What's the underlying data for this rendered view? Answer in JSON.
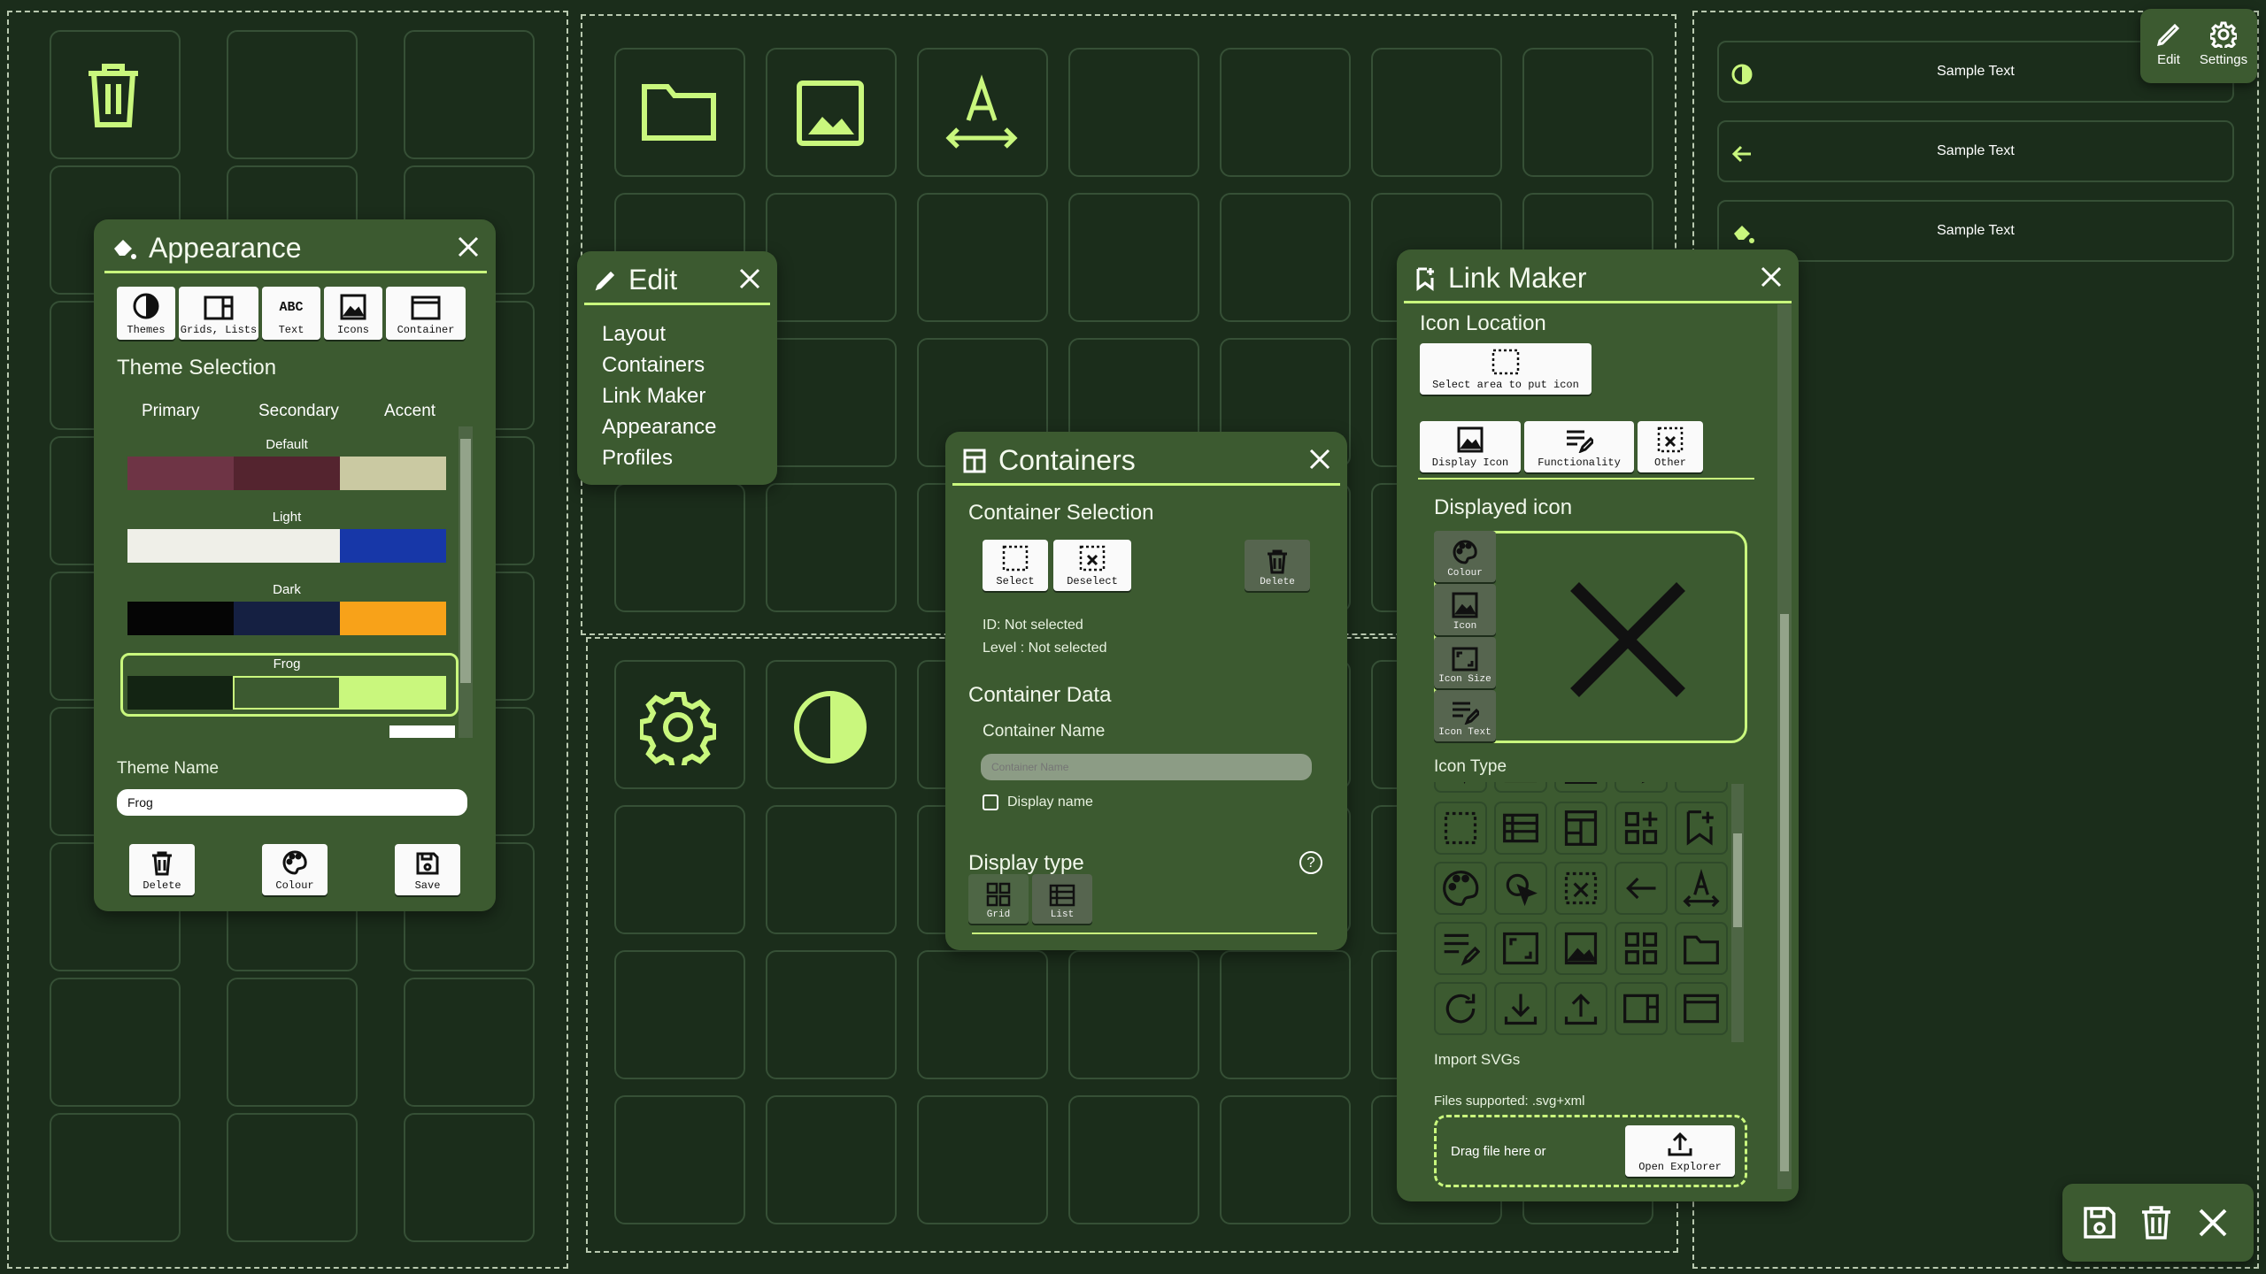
{
  "toolbar": {
    "edit_label": "Edit",
    "settings_label": "Settings"
  },
  "samples": [
    {
      "text": "Sample Text",
      "icon": "half-circle-icon"
    },
    {
      "text": "Sample Text",
      "icon": "arrow-left-icon"
    },
    {
      "text": "Sample Text",
      "icon": "paint-bucket-icon"
    }
  ],
  "appearance": {
    "title": "Appearance",
    "tabs": [
      "Themes",
      "Grids, Lists",
      "Text",
      "Icons",
      "Container"
    ],
    "section": "Theme Selection",
    "columns": [
      "Primary",
      "Secondary",
      "Accent"
    ],
    "themes": [
      {
        "name": "Default",
        "colors": [
          "#6e3445",
          "#54242f",
          "#cac9a2"
        ]
      },
      {
        "name": "Light",
        "colors": [
          "#efefe8",
          "#efefe8",
          "#1737a8"
        ]
      },
      {
        "name": "Dark",
        "colors": [
          "#050505",
          "#152042",
          "#f8a219"
        ]
      },
      {
        "name": "Frog",
        "colors": [
          "#132413",
          "#3c5a30",
          "#c9f77d"
        ]
      }
    ],
    "theme_name_label": "Theme Name",
    "theme_name_value": "Frog",
    "buttons": [
      "Delete",
      "Colour",
      "Save"
    ]
  },
  "edit_menu": {
    "title": "Edit",
    "items": [
      "Layout",
      "Containers",
      "Link Maker",
      "Appearance",
      "Profiles"
    ]
  },
  "containers": {
    "title": "Containers",
    "selection_heading": "Container Selection",
    "select_label": "Select",
    "deselect_label": "Deselect",
    "delete_label": "Delete",
    "id_text": "ID: Not selected",
    "level_text": "Level : Not selected",
    "data_heading": "Container Data",
    "name_label": "Container Name",
    "name_placeholder": "Container Name",
    "display_name_label": "Display name",
    "display_type_heading": "Display type",
    "grid_label": "Grid",
    "list_label": "List"
  },
  "link_maker": {
    "title": "Link Maker",
    "icon_location": "Icon Location",
    "select_area_label": "Select area to put icon",
    "tabs": [
      "Display Icon",
      "Functionality",
      "Other"
    ],
    "displayed_icon_heading": "Displayed icon",
    "side_buttons": [
      "Colour",
      "Icon",
      "Icon Size",
      "Icon Text"
    ],
    "icon_type_heading": "Icon Type",
    "import_heading": "Import SVGs",
    "files_supported": "Files supported: .svg+xml",
    "drag_text": "Drag file here or",
    "open_explorer": "Open Explorer"
  },
  "colors": {
    "accent": "#c9f77d",
    "panel": "#3c5a30",
    "background": "#1b2d1b"
  }
}
